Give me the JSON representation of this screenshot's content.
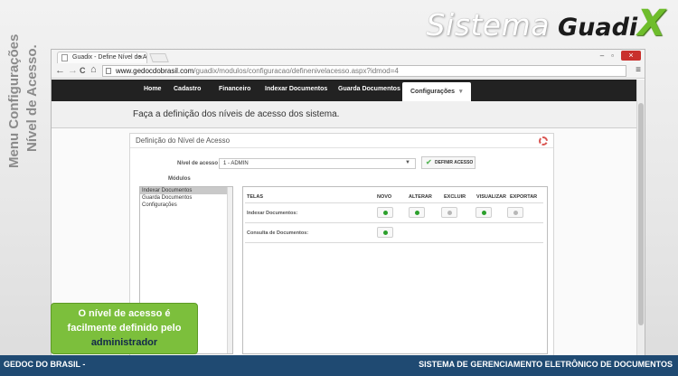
{
  "brand": {
    "part1": "Sistema",
    "part2": "Guadi",
    "part3": "X"
  },
  "side_caption": {
    "line1": "Menu Configurações",
    "line2": "Nível de Acesso."
  },
  "browser": {
    "tab_title": "Guadix - Define Nível de A",
    "tab_close": "×",
    "url_host": "www.gedocdobrasil.com",
    "url_path": "/guadix/modulos/configuracao/definenivelacesso.aspx?idmod=4",
    "window_min": "–",
    "window_max": "▫",
    "window_close": "×",
    "back": "←",
    "forward": "→",
    "reload": "C",
    "home": "⌂",
    "menu": "≡"
  },
  "nav": {
    "items": [
      "Home",
      "Cadastro",
      "Financeiro",
      "Indexar Documentos",
      "Guarda Documentos"
    ],
    "active": "Configurações",
    "active_caret": "▾"
  },
  "subheader": "Faça a definição dos níveis de acesso dos sistema.",
  "panel": {
    "title": "Definição do Nível de Acesso",
    "nivel_label": "Nível de acesso",
    "nivel_value": "1 - ADMIN",
    "select_arrow": "▼",
    "define_button": "DEFINIR ACESSO",
    "define_check": "✔",
    "modulos_label": "Módulos",
    "modules": [
      "Indexar Documentos",
      "Guarda Documentos",
      "Configurações"
    ],
    "selected_module_index": 0,
    "columns": [
      "TELAS",
      "NOVO",
      "ALTERAR",
      "EXCLUIR",
      "VISUALIZAR",
      "EXPORTAR"
    ],
    "rows": [
      {
        "label": "Indexar Documentos:",
        "toggles": [
          "on",
          "on",
          "off",
          "on",
          "off"
        ]
      },
      {
        "label": "Consulta de Documentos:",
        "toggles": [
          "on"
        ]
      }
    ]
  },
  "callout": {
    "line1": "O nível de acesso é",
    "line2": "facilmente definido pelo",
    "line3": "administrador"
  },
  "footer": {
    "left": "GEDOC DO BRASIL -",
    "right": "SISTEMA DE GERENCIAMENTO ELETRÔNICO DE DOCUMENTOS"
  },
  "colors": {
    "toggle_on": "#2ca02c",
    "toggle_off": "#b7b7b7",
    "footer_bg": "#1f4a72",
    "callout_bg": "#7cbf3c",
    "brand_x": "#6ebd2b"
  }
}
